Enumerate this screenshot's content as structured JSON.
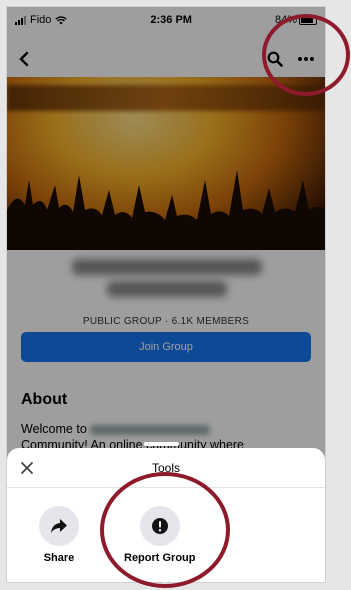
{
  "status_bar": {
    "carrier": "Fido",
    "time": "2:36 PM",
    "battery": "84%"
  },
  "nav": {
    "back_icon": "back-arrow-icon",
    "search_icon": "search-icon",
    "more_icon": "more-icon"
  },
  "group": {
    "meta": "PUBLIC GROUP · 6.1K MEMBERS",
    "join_label": "Join Group"
  },
  "about": {
    "title": "About",
    "text_start": "Welcome to",
    "text_rest": "Community! An online community where"
  },
  "sheet": {
    "title": "Tools",
    "tools": [
      {
        "label": "Share",
        "icon": "share-arrow-icon"
      },
      {
        "label": "Report Group",
        "icon": "alert-icon"
      }
    ]
  },
  "colors": {
    "accent": "#1877f2",
    "annotation": "#8e1b2b"
  }
}
